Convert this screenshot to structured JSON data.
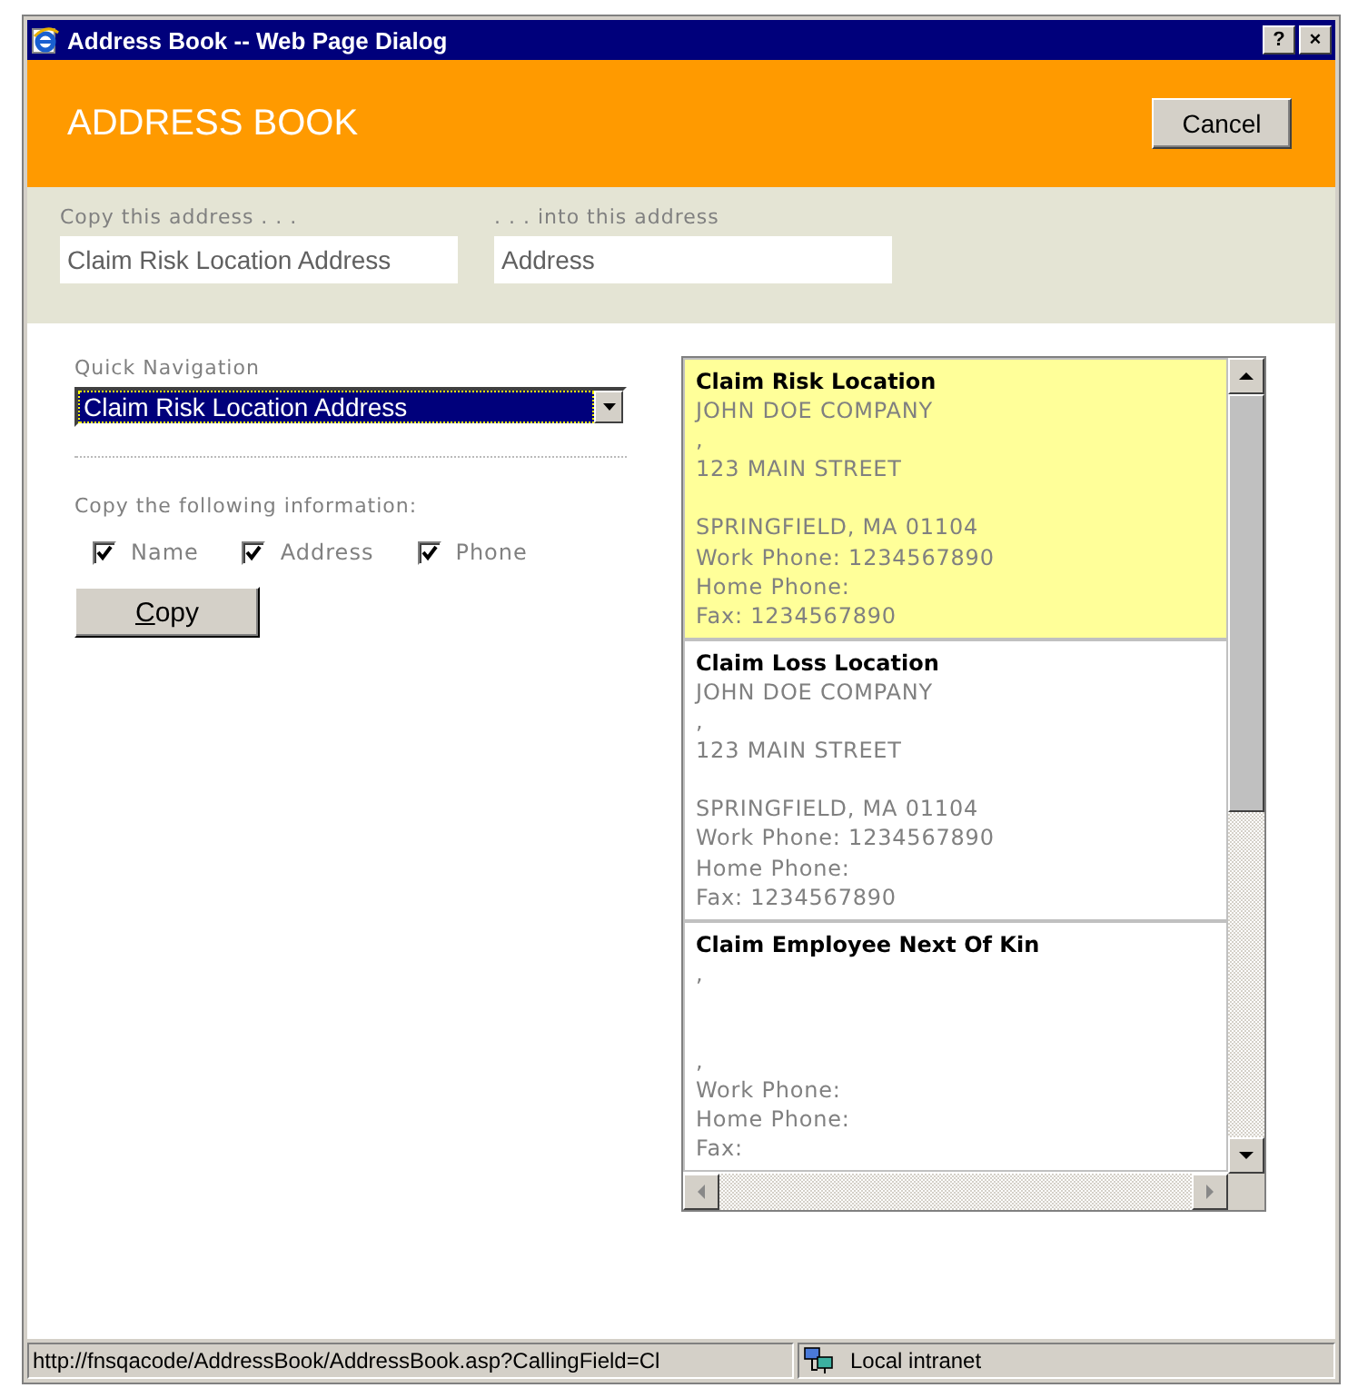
{
  "window": {
    "title": "Address Book -- Web Page Dialog",
    "controls": [
      "?",
      "×"
    ]
  },
  "header": {
    "title": "ADDRESS BOOK",
    "cancel": "Cancel"
  },
  "copy_bar": {
    "from_label": "Copy this address . . .",
    "from_value": "Claim Risk Location Address",
    "to_label": ". . . into this address",
    "to_value": "Address"
  },
  "quick_navigation": {
    "label": "Quick Navigation",
    "value": "Claim Risk Location Address"
  },
  "copy_options": {
    "label": "Copy the following information:",
    "checkboxes": [
      {
        "label": "Name",
        "checked": true
      },
      {
        "label": "Address",
        "checked": true
      },
      {
        "label": "Phone",
        "checked": true
      }
    ],
    "button": "Copy"
  },
  "addresses": [
    {
      "title": "Claim Risk Location",
      "selected": true,
      "lines": [
        {
          "kind": "text",
          "text": "JOHN DOE COMPANY"
        },
        {
          "kind": "text",
          "text": ","
        },
        {
          "kind": "text",
          "text": "123 MAIN STREET"
        },
        {
          "kind": "blank"
        },
        {
          "kind": "text",
          "text": "SPRINGFIELD, MA 01104"
        },
        {
          "kind": "text",
          "text": "Work Phone: 1234567890"
        },
        {
          "kind": "text",
          "text": "Home Phone:"
        },
        {
          "kind": "text",
          "text": "Fax: 1234567890"
        }
      ]
    },
    {
      "title": "Claim Loss Location",
      "selected": false,
      "lines": [
        {
          "kind": "text",
          "text": "JOHN DOE COMPANY"
        },
        {
          "kind": "text",
          "text": ","
        },
        {
          "kind": "text",
          "text": "123 MAIN STREET"
        },
        {
          "kind": "blank"
        },
        {
          "kind": "text",
          "text": "SPRINGFIELD, MA 01104"
        },
        {
          "kind": "text",
          "text": "Work Phone: 1234567890"
        },
        {
          "kind": "text",
          "text": "Home Phone:"
        },
        {
          "kind": "text",
          "text": "Fax: 1234567890"
        }
      ]
    },
    {
      "title": "Claim Employee Next Of Kin",
      "selected": false,
      "lines": [
        {
          "kind": "text",
          "text": ","
        },
        {
          "kind": "blank"
        },
        {
          "kind": "blank"
        },
        {
          "kind": "text",
          "text": ","
        },
        {
          "kind": "text",
          "text": "Work Phone:"
        },
        {
          "kind": "text",
          "text": "Home Phone:"
        },
        {
          "kind": "text",
          "text": "Fax:"
        }
      ]
    }
  ],
  "status_bar": {
    "url": "http://fnsqacode/AddressBook/AddressBook.asp?CallingField=Cl",
    "zone": "Local intranet"
  }
}
